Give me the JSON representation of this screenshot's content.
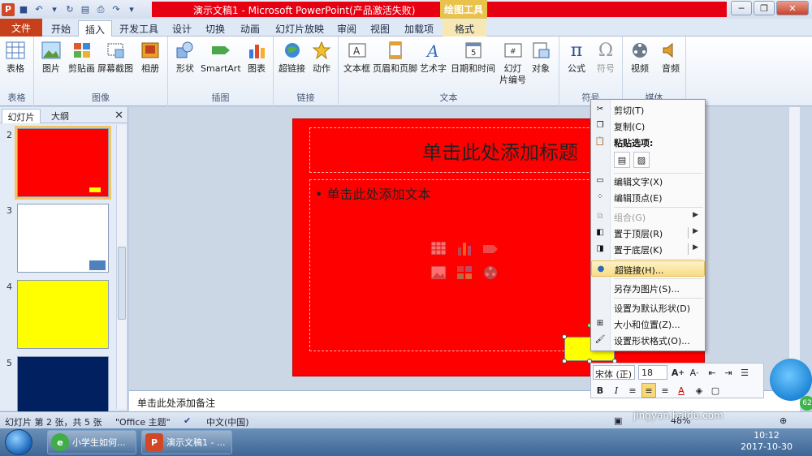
{
  "window": {
    "title": "演示文稿1 - Microsoft PowerPoint(产品激活失败)",
    "contextual_tab_group": "绘图工具",
    "brand_red": "#e60012"
  },
  "ribbon_tabs": [
    "文件",
    "开始",
    "插入",
    "开发工具",
    "设计",
    "切换",
    "动画",
    "幻灯片放映",
    "审阅",
    "视图",
    "加载项",
    "格式"
  ],
  "ribbon": {
    "groups": [
      {
        "label": "表格",
        "buttons": [
          "表格"
        ]
      },
      {
        "label": "图像",
        "buttons": [
          "图片",
          "剪贴画",
          "屏幕截图",
          "相册"
        ]
      },
      {
        "label": "插图",
        "buttons": [
          "形状",
          "SmartArt",
          "图表"
        ]
      },
      {
        "label": "链接",
        "buttons": [
          "超链接",
          "动作"
        ]
      },
      {
        "label": "文本",
        "buttons": [
          "文本框",
          "页眉和页脚",
          "艺术字",
          "日期和时间",
          "幻灯",
          "片编号",
          "对象"
        ]
      },
      {
        "label": "符号",
        "buttons": [
          "公式",
          "符号"
        ]
      },
      {
        "label": "媒体",
        "buttons": [
          "视频",
          "音频"
        ]
      }
    ]
  },
  "left_panel": {
    "tabs": [
      "幻灯片",
      "大纲"
    ],
    "thumbnails": [
      {
        "number": "2",
        "color": "#ff0000",
        "accent": "#ffff00",
        "selected": true
      },
      {
        "number": "3",
        "color": "#ffffff",
        "accent": "#4f81bd",
        "selected": false
      },
      {
        "number": "4",
        "color": "#ffff00",
        "accent": "",
        "selected": false
      },
      {
        "number": "5",
        "color": "#002060",
        "accent": "",
        "selected": false
      }
    ]
  },
  "slide": {
    "title_placeholder": "单击此处添加标题",
    "body_placeholder": "单击此处添加文本",
    "background": "#ff0000",
    "shape_fill": "#ffff00"
  },
  "notes_placeholder": "单击此处添加备注",
  "context_menu": {
    "cut": "剪切(T)",
    "copy": "复制(C)",
    "paste_options": "粘贴选项:",
    "edit_text": "编辑文字(X)",
    "edit_points": "编辑顶点(E)",
    "group": "组合(G)",
    "bring_to_front": "置于顶层(R)",
    "send_to_back": "置于底层(K)",
    "hyperlink": "超链接(H)...",
    "save_as_picture": "另存为图片(S)...",
    "set_default_shape": "设置为默认形状(D)",
    "size_position": "大小和位置(Z)...",
    "format_shape": "设置形状格式(O)..."
  },
  "mini_toolbar": {
    "font": "宋体 (正)",
    "size": "18"
  },
  "status_bar": {
    "slide_info": "幻灯片 第 2 张，共 5 张",
    "theme": "\"Office 主题\"",
    "language": "中文(中国)",
    "zoom": "48%"
  },
  "taskbar": {
    "task1": "小学生如何...",
    "task2": "演示文稿1 - ...",
    "time": "10:12",
    "date": "2017-10-30"
  },
  "watermark": "jingyan.baidu.com"
}
